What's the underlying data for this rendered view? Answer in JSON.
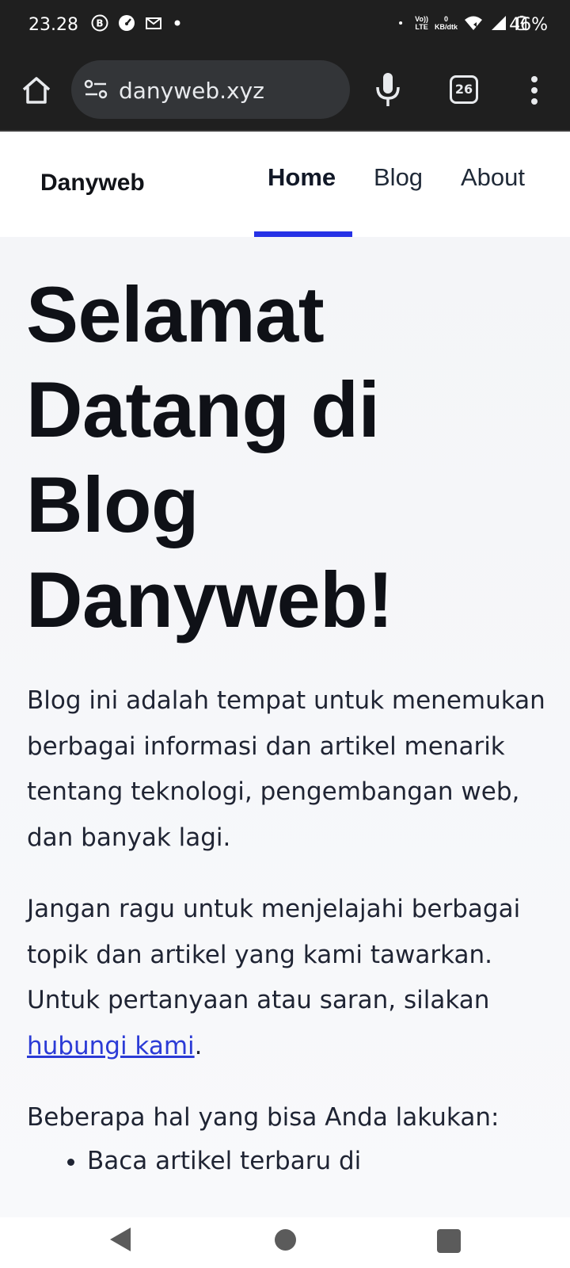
{
  "status_bar": {
    "time": "23.28",
    "battery": "46%",
    "net_speed_value": "0",
    "net_speed_unit": "KB/dtk",
    "volte_top": "Vo))",
    "volte_bottom": "LTE"
  },
  "browser": {
    "url": "danyweb.xyz",
    "tab_count": "26"
  },
  "site": {
    "brand": "Danyweb",
    "nav": {
      "home": "Home",
      "blog": "Blog",
      "about": "About"
    }
  },
  "content": {
    "title": "Selamat Datang di Blog Danyweb!",
    "paragraph1": "Blog ini adalah tempat untuk menemukan berbagai informasi dan artikel menarik tentang teknologi, pengembangan web, dan banyak lagi.",
    "paragraph2_before": "Jangan ragu untuk menjelajahi berbagai topik dan artikel yang kami tawarkan. Untuk pertanyaan atau saran, silakan ",
    "paragraph2_link": "hubungi kami",
    "paragraph2_after": ".",
    "paragraph3": "Beberapa hal yang bisa Anda lakukan:",
    "list_items": [
      "Baca artikel terbaru di"
    ]
  }
}
